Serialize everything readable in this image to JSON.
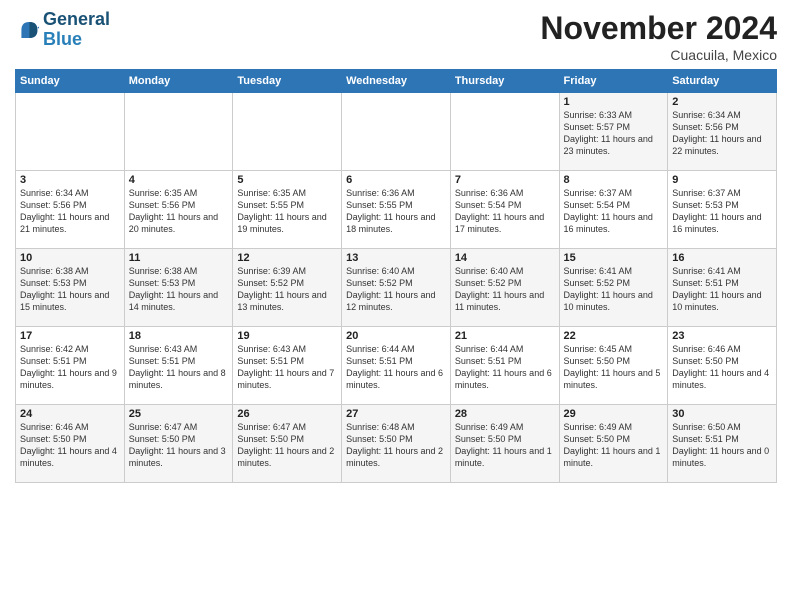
{
  "header": {
    "logo_line1": "General",
    "logo_line2": "Blue",
    "month": "November 2024",
    "location": "Cuacuila, Mexico"
  },
  "weekdays": [
    "Sunday",
    "Monday",
    "Tuesday",
    "Wednesday",
    "Thursday",
    "Friday",
    "Saturday"
  ],
  "weeks": [
    [
      {
        "day": "",
        "text": ""
      },
      {
        "day": "",
        "text": ""
      },
      {
        "day": "",
        "text": ""
      },
      {
        "day": "",
        "text": ""
      },
      {
        "day": "",
        "text": ""
      },
      {
        "day": "1",
        "text": "Sunrise: 6:33 AM\nSunset: 5:57 PM\nDaylight: 11 hours and 23 minutes."
      },
      {
        "day": "2",
        "text": "Sunrise: 6:34 AM\nSunset: 5:56 PM\nDaylight: 11 hours and 22 minutes."
      }
    ],
    [
      {
        "day": "3",
        "text": "Sunrise: 6:34 AM\nSunset: 5:56 PM\nDaylight: 11 hours and 21 minutes."
      },
      {
        "day": "4",
        "text": "Sunrise: 6:35 AM\nSunset: 5:56 PM\nDaylight: 11 hours and 20 minutes."
      },
      {
        "day": "5",
        "text": "Sunrise: 6:35 AM\nSunset: 5:55 PM\nDaylight: 11 hours and 19 minutes."
      },
      {
        "day": "6",
        "text": "Sunrise: 6:36 AM\nSunset: 5:55 PM\nDaylight: 11 hours and 18 minutes."
      },
      {
        "day": "7",
        "text": "Sunrise: 6:36 AM\nSunset: 5:54 PM\nDaylight: 11 hours and 17 minutes."
      },
      {
        "day": "8",
        "text": "Sunrise: 6:37 AM\nSunset: 5:54 PM\nDaylight: 11 hours and 16 minutes."
      },
      {
        "day": "9",
        "text": "Sunrise: 6:37 AM\nSunset: 5:53 PM\nDaylight: 11 hours and 16 minutes."
      }
    ],
    [
      {
        "day": "10",
        "text": "Sunrise: 6:38 AM\nSunset: 5:53 PM\nDaylight: 11 hours and 15 minutes."
      },
      {
        "day": "11",
        "text": "Sunrise: 6:38 AM\nSunset: 5:53 PM\nDaylight: 11 hours and 14 minutes."
      },
      {
        "day": "12",
        "text": "Sunrise: 6:39 AM\nSunset: 5:52 PM\nDaylight: 11 hours and 13 minutes."
      },
      {
        "day": "13",
        "text": "Sunrise: 6:40 AM\nSunset: 5:52 PM\nDaylight: 11 hours and 12 minutes."
      },
      {
        "day": "14",
        "text": "Sunrise: 6:40 AM\nSunset: 5:52 PM\nDaylight: 11 hours and 11 minutes."
      },
      {
        "day": "15",
        "text": "Sunrise: 6:41 AM\nSunset: 5:52 PM\nDaylight: 11 hours and 10 minutes."
      },
      {
        "day": "16",
        "text": "Sunrise: 6:41 AM\nSunset: 5:51 PM\nDaylight: 11 hours and 10 minutes."
      }
    ],
    [
      {
        "day": "17",
        "text": "Sunrise: 6:42 AM\nSunset: 5:51 PM\nDaylight: 11 hours and 9 minutes."
      },
      {
        "day": "18",
        "text": "Sunrise: 6:43 AM\nSunset: 5:51 PM\nDaylight: 11 hours and 8 minutes."
      },
      {
        "day": "19",
        "text": "Sunrise: 6:43 AM\nSunset: 5:51 PM\nDaylight: 11 hours and 7 minutes."
      },
      {
        "day": "20",
        "text": "Sunrise: 6:44 AM\nSunset: 5:51 PM\nDaylight: 11 hours and 6 minutes."
      },
      {
        "day": "21",
        "text": "Sunrise: 6:44 AM\nSunset: 5:51 PM\nDaylight: 11 hours and 6 minutes."
      },
      {
        "day": "22",
        "text": "Sunrise: 6:45 AM\nSunset: 5:50 PM\nDaylight: 11 hours and 5 minutes."
      },
      {
        "day": "23",
        "text": "Sunrise: 6:46 AM\nSunset: 5:50 PM\nDaylight: 11 hours and 4 minutes."
      }
    ],
    [
      {
        "day": "24",
        "text": "Sunrise: 6:46 AM\nSunset: 5:50 PM\nDaylight: 11 hours and 4 minutes."
      },
      {
        "day": "25",
        "text": "Sunrise: 6:47 AM\nSunset: 5:50 PM\nDaylight: 11 hours and 3 minutes."
      },
      {
        "day": "26",
        "text": "Sunrise: 6:47 AM\nSunset: 5:50 PM\nDaylight: 11 hours and 2 minutes."
      },
      {
        "day": "27",
        "text": "Sunrise: 6:48 AM\nSunset: 5:50 PM\nDaylight: 11 hours and 2 minutes."
      },
      {
        "day": "28",
        "text": "Sunrise: 6:49 AM\nSunset: 5:50 PM\nDaylight: 11 hours and 1 minute."
      },
      {
        "day": "29",
        "text": "Sunrise: 6:49 AM\nSunset: 5:50 PM\nDaylight: 11 hours and 1 minute."
      },
      {
        "day": "30",
        "text": "Sunrise: 6:50 AM\nSunset: 5:51 PM\nDaylight: 11 hours and 0 minutes."
      }
    ]
  ]
}
